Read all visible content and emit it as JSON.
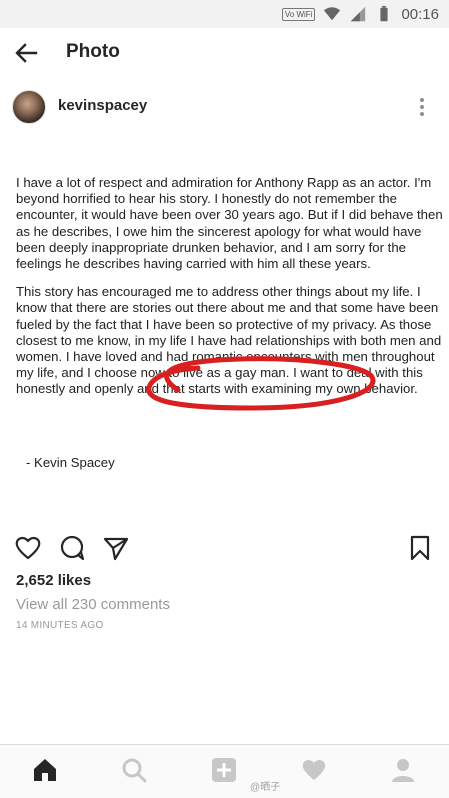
{
  "status_bar": {
    "vowifi_label": "Vo WiFi",
    "time": "00:16"
  },
  "app_bar": {
    "title": "Photo"
  },
  "post": {
    "username": "kevinspacey",
    "paragraph_1": "I have a lot of respect and admiration for Anthony Rapp as an actor. I'm beyond horrified to hear his story. I honestly do not remember the encounter, it would have been over 30 years ago. But if I did behave then as he describes, I owe him the sincerest apology for what would have been deeply inappropriate drunken behavior, and I am sorry for the feelings he describes having carried with him all these years.",
    "paragraph_2": "This story has encouraged me to address other things about my life. I know that there are stories out there about me and that some have been fueled by the fact that I have been so protective of my privacy. As those closest to me know, in my life I have had relationships with both men and women. I have loved and had romantic encounters with men throughout my life, and I choose now to live as a gay man. I want to deal with this honestly and openly and that starts with examining my own behavior.",
    "signature": "- Kevin Spacey",
    "highlight_color": "#d91f1f",
    "likes": "2,652 likes",
    "comments_link": "View all 230 comments",
    "time_ago": "14 MINUTES AGO"
  },
  "icons": {
    "back": "back-arrow-icon",
    "more": "more-vertical-icon",
    "like": "heart-icon",
    "comment": "comment-icon",
    "share": "send-icon",
    "save": "bookmark-icon",
    "nav_home": "home-icon",
    "nav_search": "search-icon",
    "nav_add": "add-icon",
    "nav_activity": "heart-icon",
    "nav_profile": "profile-icon"
  },
  "watermark": "@晒子"
}
